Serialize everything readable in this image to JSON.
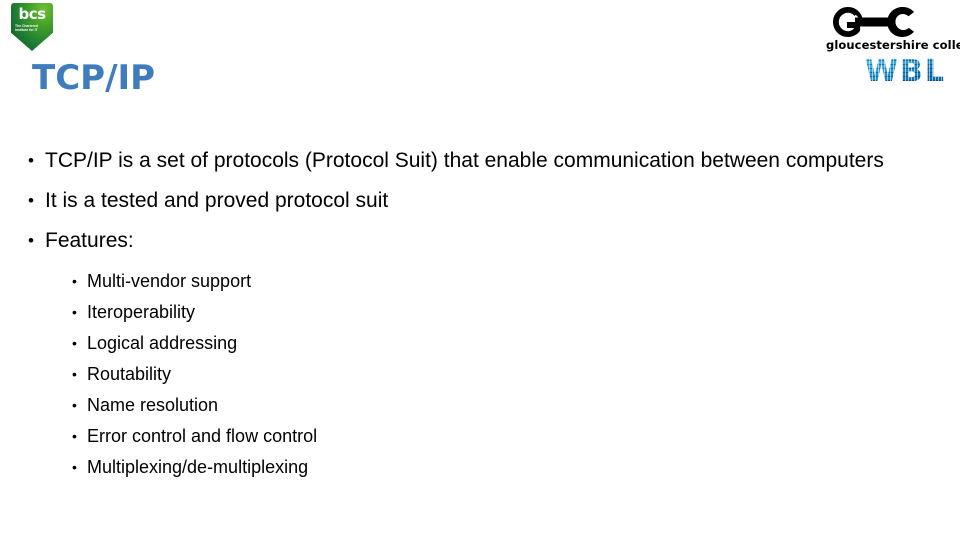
{
  "slide": {
    "title": "TCP/IP",
    "title_color": "#3E7CBE",
    "background_color": "#FFFFFF",
    "text_color": "#000000"
  },
  "logos": {
    "bcs": {
      "wordmark": "bcs",
      "tagline": "The Chartered Institute for IT",
      "shield_color_light": "#5BA829",
      "shield_color_dark": "#0A5226"
    },
    "gc": {
      "monogram": "GC",
      "name": "gloucestershire college",
      "color": "#000000"
    },
    "wbl": {
      "text": "WBL",
      "color": "#1172B0"
    }
  },
  "bullets": [
    {
      "marker": "•",
      "text": "TCP/IP is a set of protocols (Protocol Suit) that enable communication between computers"
    },
    {
      "marker": "•",
      "text": "It is a tested and proved protocol suit"
    },
    {
      "marker": "•",
      "text": "Features:"
    }
  ],
  "features": [
    {
      "marker": "•",
      "text": "Multi-vendor support"
    },
    {
      "marker": "•",
      "text": "Iteroperability"
    },
    {
      "marker": "•",
      "text": "Logical addressing"
    },
    {
      "marker": "•",
      "text": "Routability"
    },
    {
      "marker": "•",
      "text": "Name resolution"
    },
    {
      "marker": "•",
      "text": "Error control and flow control"
    },
    {
      "marker": "•",
      "text": "Multiplexing/de-multiplexing"
    }
  ]
}
